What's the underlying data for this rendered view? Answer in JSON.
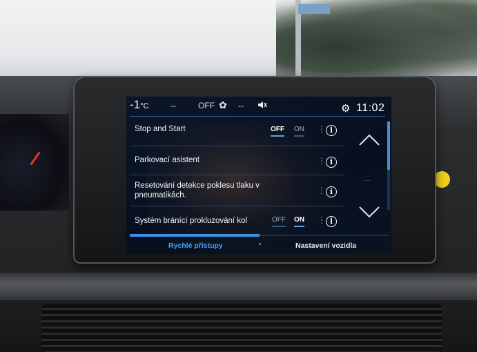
{
  "status_bar": {
    "temperature": "-1",
    "temperature_unit": "°C",
    "fan_speed": "--",
    "ac_state": "OFF",
    "fan_icon": "fan-icon",
    "volume": "--",
    "mute_icon": "speaker-muted-icon",
    "time": "11:02"
  },
  "settings_list": {
    "items": [
      {
        "label": "Stop and Start",
        "toggle": {
          "off_label": "OFF",
          "on_label": "ON",
          "state": "OFF"
        }
      },
      {
        "label": "Parkovací asistent"
      },
      {
        "label": "Resetování detekce poklesu tlaku v pneumatikách."
      },
      {
        "label": "Systém bránící prokluzování kol",
        "toggle": {
          "off_label": "OFF",
          "on_label": "ON",
          "state": "ON"
        }
      }
    ],
    "info_glyph": "i",
    "menu_glyph": "⋮"
  },
  "scroll": {
    "up_glyph": "⌃",
    "down_glyph": "⌄",
    "dots": "...",
    "position_fraction": 0.0
  },
  "tabs": [
    {
      "label": "Rychlé přístupy",
      "active": true
    },
    {
      "label": "Nastavení vozidla",
      "active": false
    }
  ],
  "colors": {
    "accent": "#3d8fe6",
    "screen_bg": "#07101f",
    "text": "#f0f4f8"
  }
}
